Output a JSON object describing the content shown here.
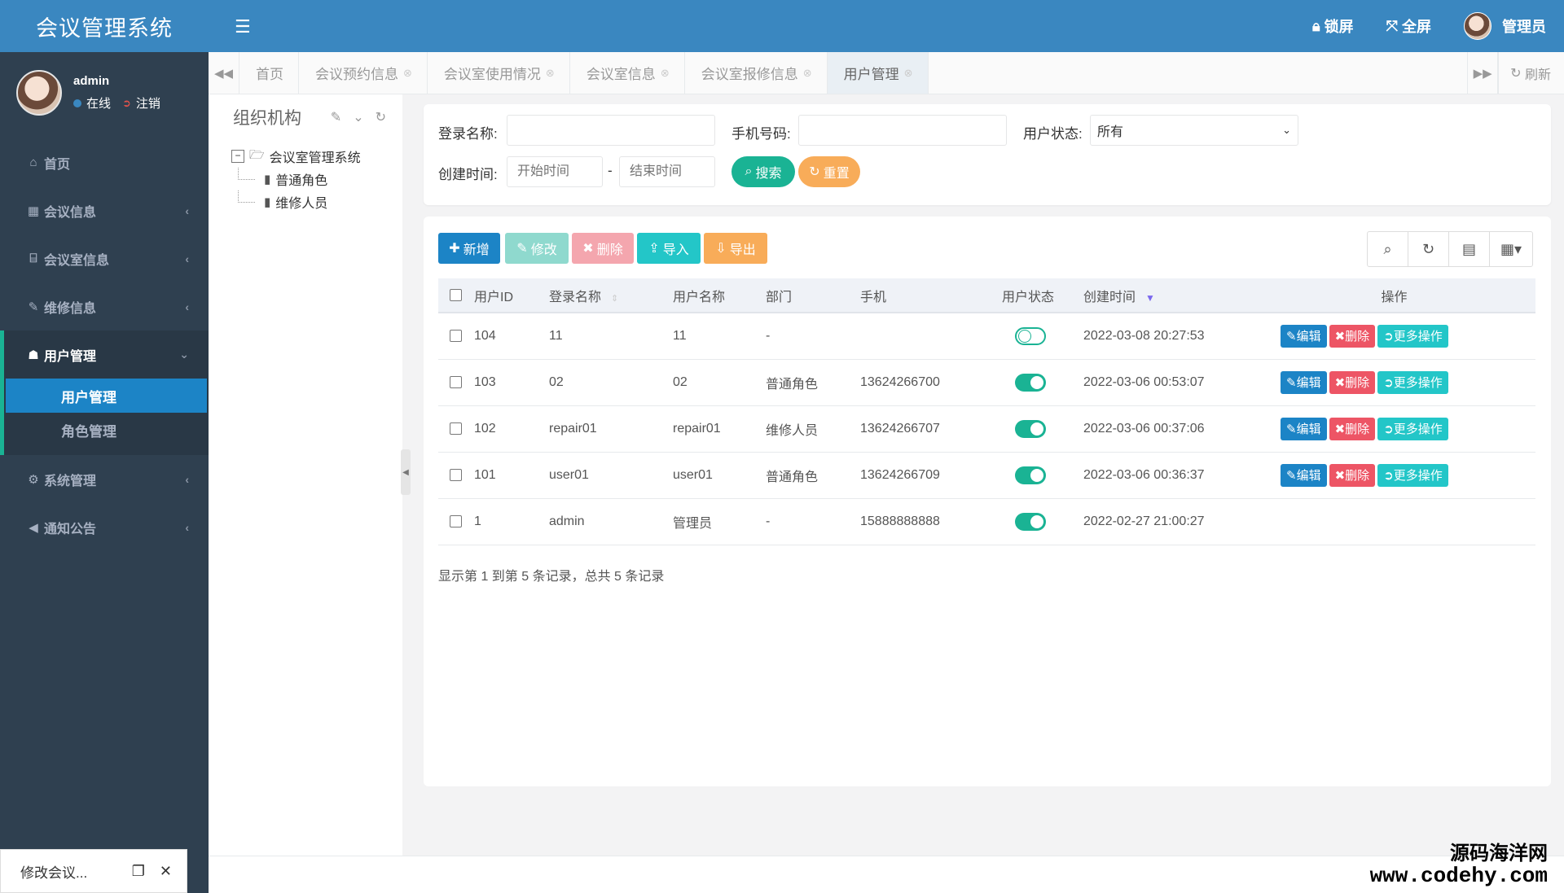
{
  "app": {
    "title": "会议管理系统"
  },
  "colors": {
    "primary": "#3a87c0",
    "sidebar": "#2f4050",
    "green": "#1ab394",
    "blue": "#1c84c6",
    "red": "#ed5565",
    "cyan": "#23c6c8",
    "orange": "#f8ac59"
  },
  "user": {
    "name": "admin",
    "status": "在线",
    "logout": "注销"
  },
  "topbar": {
    "lock": "锁屏",
    "fullscreen": "全屏",
    "admin": "管理员"
  },
  "menu": {
    "home": "首页",
    "meeting_info": "会议信息",
    "room_info": "会议室信息",
    "repair_info": "维修信息",
    "user_mgmt": "用户管理",
    "sub_user": "用户管理",
    "sub_role": "角色管理",
    "system": "系统管理",
    "notice": "通知公告"
  },
  "tabs": [
    "首页",
    "会议预约信息",
    "会议室使用情况",
    "会议室信息",
    "会议室报修信息",
    "用户管理"
  ],
  "tabs_refresh": "刷新",
  "org": {
    "title": "组织机构",
    "root": "会议室管理系统",
    "children": [
      "普通角色",
      "维修人员"
    ]
  },
  "search": {
    "login_label": "登录名称:",
    "phone_label": "手机号码:",
    "status_label": "用户状态:",
    "status_value": "所有",
    "time_label": "创建时间:",
    "start_placeholder": "开始时间",
    "end_placeholder": "结束时间",
    "search_btn": "搜索",
    "reset_btn": "重置"
  },
  "toolbar": {
    "add": "新增",
    "edit": "修改",
    "delete": "删除",
    "import": "导入",
    "export": "导出"
  },
  "table": {
    "headers": {
      "id": "用户ID",
      "login": "登录名称",
      "name": "用户名称",
      "dept": "部门",
      "phone": "手机",
      "status": "用户状态",
      "created": "创建时间",
      "ops": "操作"
    },
    "rows": [
      {
        "id": "104",
        "login": "11",
        "name": "11",
        "dept": "-",
        "phone": "",
        "enabled": false,
        "created": "2022-03-08 20:27:53"
      },
      {
        "id": "103",
        "login": "02",
        "name": "02",
        "dept": "普通角色",
        "phone": "13624266700",
        "enabled": true,
        "created": "2022-03-06 00:53:07"
      },
      {
        "id": "102",
        "login": "repair01",
        "name": "repair01",
        "dept": "维修人员",
        "phone": "13624266707",
        "enabled": true,
        "created": "2022-03-06 00:37:06"
      },
      {
        "id": "101",
        "login": "user01",
        "name": "user01",
        "dept": "普通角色",
        "phone": "13624266709",
        "enabled": true,
        "created": "2022-03-06 00:36:37"
      },
      {
        "id": "1",
        "login": "admin",
        "name": "管理员",
        "dept": "-",
        "phone": "15888888888",
        "enabled": true,
        "created": "2022-02-27 21:00:27"
      }
    ],
    "op_edit": "编辑",
    "op_delete": "删除",
    "op_more": "更多操作",
    "pager_info": "显示第 1 到第 5 条记录，总共 5 条记录"
  },
  "minimized_window": {
    "title": "修改会议..."
  },
  "watermark": {
    "line1": "源码海洋网",
    "line2": "www.codehy.com"
  }
}
